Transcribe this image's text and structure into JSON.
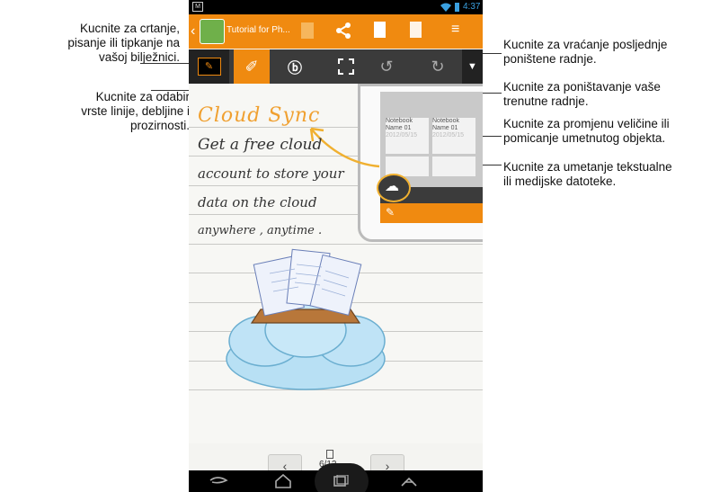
{
  "app": {
    "title": "Tutorial for Ph...",
    "time": "4:37",
    "page_indicator": "6/12",
    "prev_page": "‹",
    "next_page": "›"
  },
  "callouts": {
    "draw_write": "Kucnite za crtanje,\npisanje ili tipkanje na\nvašoj bilježnici.",
    "line_type": "Kucnite za odabir\nvrste linije, debljine i\nprozirnosti.",
    "redo": "Kucnite za vraćanje posljednje\nponištene radnje.",
    "undo": "Kucnite za poništavanje vaše\ntrenutne radnje.",
    "resize_move": "Kucnite za promjenu veličine ili\npomicanje umetnutog objekta.",
    "insert": "Kucnite za umetanje tekstualne\nili medijske datoteke."
  },
  "note": {
    "heading": "Cloud Sync",
    "lines": [
      "Get a free cloud",
      "account to store your",
      "data on the cloud",
      "anywhere , anytime ."
    ]
  },
  "inset": {
    "tiles": [
      {
        "name": "Notebook Name 01",
        "date": "2012/05/15"
      },
      {
        "name": "Notebook Name 01",
        "date": "2012/05/15"
      }
    ]
  },
  "colors": {
    "accent": "#f08a10",
    "toolbar": "#3b3b3b",
    "heading": "#f0a030",
    "cloud": "#9fd3ee"
  },
  "icons": [
    "draw-mode-icon",
    "pen-icon",
    "insert-icon",
    "resize-icon",
    "undo-icon",
    "redo-icon",
    "overflow-icon",
    "share-icon",
    "new-page-icon",
    "delete-page-icon",
    "menu-icon",
    "back-nav-icon",
    "home-nav-icon",
    "recent-apps-icon",
    "keyboard-hide-icon",
    "cloud-sync-icon",
    "wifi-icon",
    "battery-icon",
    "notification-icon"
  ]
}
